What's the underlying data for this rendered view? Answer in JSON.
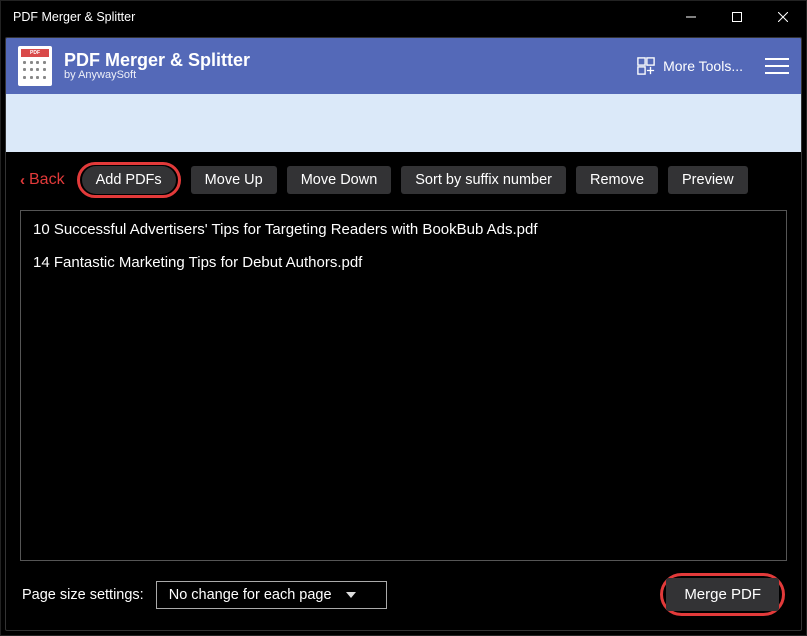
{
  "window": {
    "title": "PDF Merger & Splitter"
  },
  "banner": {
    "title": "PDF Merger & Splitter",
    "subtitle": "by AnywaySoft",
    "moreTools": "More Tools..."
  },
  "toolbar": {
    "back": "Back",
    "addPdfs": "Add PDFs",
    "moveUp": "Move Up",
    "moveDown": "Move Down",
    "sortBySuffix": "Sort by suffix number",
    "remove": "Remove",
    "preview": "Preview"
  },
  "files": [
    "10 Successful Advertisers' Tips for Targeting Readers with BookBub Ads.pdf",
    "14 Fantastic Marketing Tips for Debut Authors.pdf"
  ],
  "footer": {
    "pageSizeLabel": "Page size settings:",
    "pageSizeValue": "No change for each page",
    "mergeButton": "Merge PDF"
  }
}
